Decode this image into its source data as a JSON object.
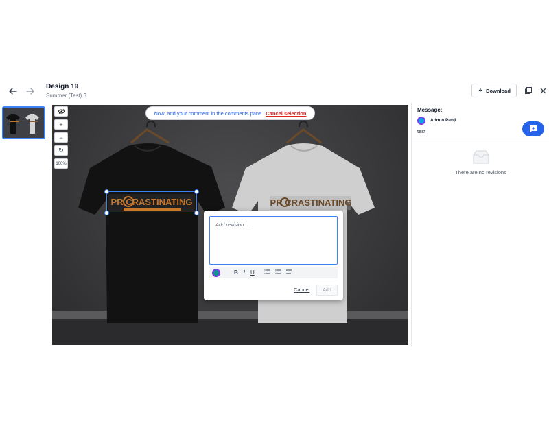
{
  "header": {
    "title": "Design 19",
    "subtitle": "Summer (Test) 3",
    "download_label": "Download"
  },
  "canvas": {
    "banner_text": "Now, add your comment in the comments pane",
    "banner_cancel": "Cancel selection",
    "zoom_label": "100%",
    "design_text": "PR   CRASTINATING",
    "design_subtext": "IS MY SECRET TALENT"
  },
  "popup": {
    "placeholder": "Add revision...",
    "cancel_label": "Cancel",
    "add_label": "Add",
    "format_bold": "B",
    "format_italic": "I",
    "format_underline": "U"
  },
  "panel": {
    "message_label": "Message:",
    "user_name": "Admin Penji",
    "message_text": "test",
    "empty_text": "There are no revisions"
  },
  "colors": {
    "accent": "#2563eb",
    "selection": "#3b82f6",
    "danger": "#dc2626",
    "print_orange": "#c8782a"
  },
  "icons": [
    "back-arrow-icon",
    "forward-arrow-icon",
    "download-icon",
    "duplicate-icon",
    "close-icon",
    "eye-off-icon",
    "plus-icon",
    "minus-icon",
    "reset-icon",
    "add-comment-icon",
    "empty-box-icon",
    "ordered-list-icon",
    "unordered-list-icon",
    "align-icon"
  ]
}
